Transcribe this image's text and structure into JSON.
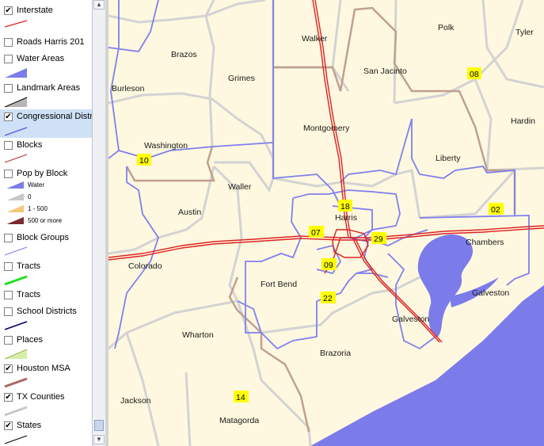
{
  "legend": {
    "layers": [
      {
        "name": "Interstate",
        "checked": true,
        "icon": "interstate-line-icon"
      },
      {
        "name": "Roads Harris 201",
        "checked": false,
        "icon": ""
      },
      {
        "name": "Water Areas",
        "checked": false,
        "icon": "water-area-icon"
      },
      {
        "name": "Landmark Areas",
        "checked": false,
        "icon": "landmark-area-icon"
      },
      {
        "name": "Congressional District",
        "checked": true,
        "icon": "congressional-district-line-icon"
      },
      {
        "name": "Blocks",
        "checked": false,
        "icon": "block-line-icon"
      },
      {
        "name": "Pop by Block",
        "checked": false,
        "icon": ""
      },
      {
        "name": "Block Groups",
        "checked": false,
        "icon": "block-group-line-icon"
      },
      {
        "name": "Tracts",
        "checked": false,
        "icon": "tract-line-icon"
      },
      {
        "name": "Tracts",
        "checked": false,
        "icon": ""
      },
      {
        "name": "School Districts",
        "checked": false,
        "icon": "school-district-line-icon"
      },
      {
        "name": "Places",
        "checked": false,
        "icon": "place-area-icon"
      },
      {
        "name": "Houston MSA",
        "checked": true,
        "icon": "msa-line-icon"
      },
      {
        "name": "TX Counties",
        "checked": true,
        "icon": "county-line-icon"
      },
      {
        "name": "States",
        "checked": true,
        "icon": "state-line-icon"
      }
    ],
    "pop_by_block_classes": [
      {
        "label": "Water",
        "color": "#7d7de8"
      },
      {
        "label": "0",
        "color": "#c8c8c8"
      },
      {
        "label": "1 - 500",
        "color": "#f0c878"
      },
      {
        "label": "500 or more",
        "color": "#7a2a2a"
      }
    ]
  },
  "map": {
    "colors": {
      "land": "#fdf8df",
      "water": "#7b7bea",
      "county_border": "#d3d3d3",
      "district_border": "#8080ee",
      "msa_border": "#c0a090",
      "interstate": "#dd2222",
      "district_label_bg": "#ffff00"
    },
    "counties": [
      {
        "name": "Walker"
      },
      {
        "name": "Polk"
      },
      {
        "name": "Tyler"
      },
      {
        "name": "Brazos"
      },
      {
        "name": "Grimes"
      },
      {
        "name": "San Jacinto"
      },
      {
        "name": "Burleson"
      },
      {
        "name": "Montgomery"
      },
      {
        "name": "Hardin"
      },
      {
        "name": "Washington"
      },
      {
        "name": "Liberty"
      },
      {
        "name": "Waller"
      },
      {
        "name": "Austin"
      },
      {
        "name": "Harris"
      },
      {
        "name": "Chambers"
      },
      {
        "name": "Colorado"
      },
      {
        "name": "Fort Bend"
      },
      {
        "name": "Galveston"
      },
      {
        "name": "Galveston"
      },
      {
        "name": "Wharton"
      },
      {
        "name": "Brazoria"
      },
      {
        "name": "Jackson"
      },
      {
        "name": "Matagorda"
      }
    ],
    "districts": [
      "08",
      "10",
      "18",
      "02",
      "07",
      "29",
      "09",
      "22",
      "14"
    ]
  }
}
